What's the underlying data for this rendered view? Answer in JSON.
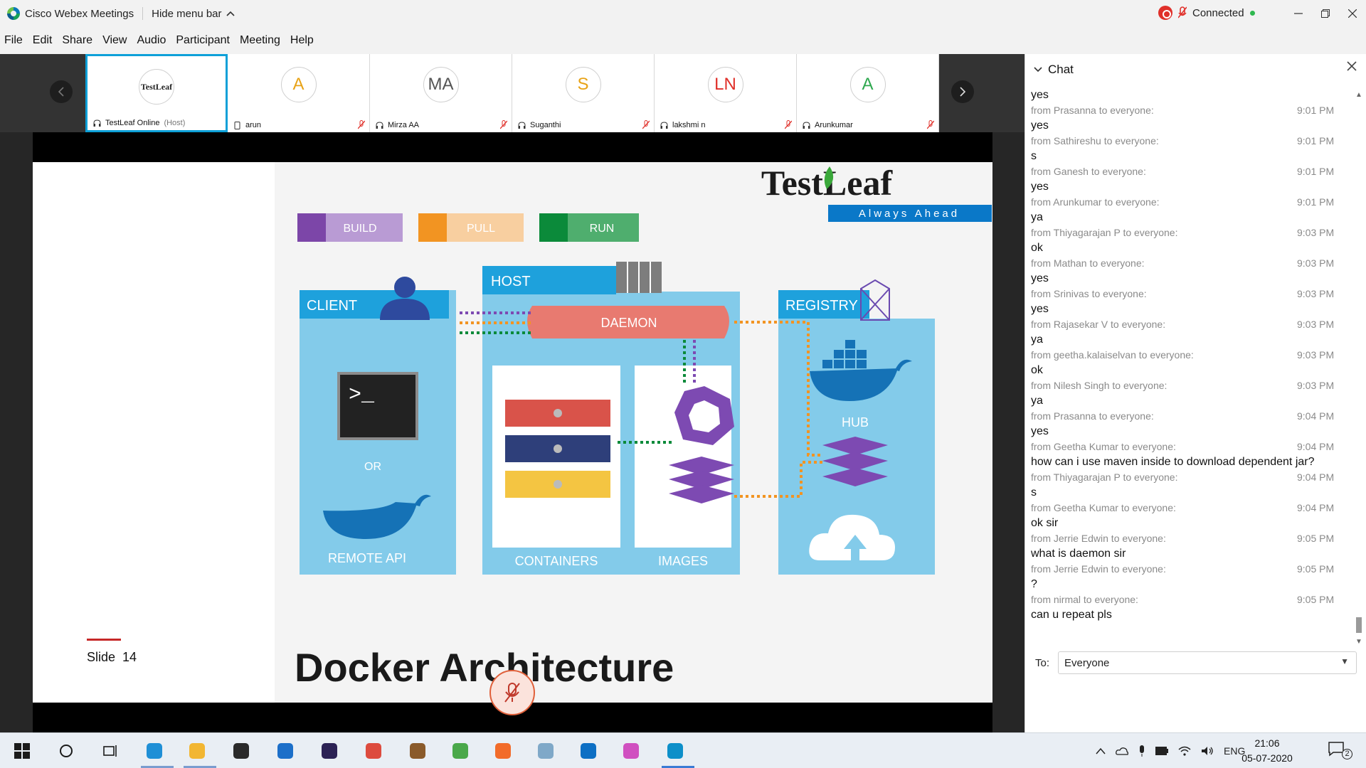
{
  "window": {
    "title": "Cisco Webex Meetings",
    "hide_menu_label": "Hide menu bar",
    "status": "Connected"
  },
  "menu": [
    "File",
    "Edit",
    "Share",
    "View",
    "Audio",
    "Participant",
    "Meeting",
    "Help"
  ],
  "participants": [
    {
      "name": "TestLeaf Online",
      "tag": "(Host)",
      "initials": "",
      "color": "#0da0d8",
      "logo": "TestLeaf"
    },
    {
      "name": "arun",
      "tag": "",
      "initials": "A",
      "color": "#e8a317"
    },
    {
      "name": "Mirza AA",
      "tag": "",
      "initials": "MA",
      "color": "#555555"
    },
    {
      "name": "Suganthi",
      "tag": "",
      "initials": "S",
      "color": "#e8a317"
    },
    {
      "name": "lakshmi n",
      "tag": "",
      "initials": "LN",
      "color": "#e0302a"
    },
    {
      "name": "Arunkumar",
      "tag": "",
      "initials": "A",
      "color": "#2fa84f"
    }
  ],
  "slide": {
    "title": "Docker Architecture",
    "slide_label": "Slide",
    "slide_number": "14",
    "logo_main": "TestLeaf",
    "logo_tag": "Always Ahead",
    "legend": [
      "BUILD",
      "PULL",
      "RUN"
    ],
    "sections": {
      "client": "CLIENT",
      "host": "HOST",
      "registry": "REGISTRY",
      "daemon": "DAEMON",
      "or": "OR",
      "remote_api": "REMOTE API",
      "containers": "CONTAINERS",
      "images": "IMAGES",
      "hub": "HUB"
    },
    "terminal_prompt": ">_"
  },
  "chat": {
    "title": "Chat",
    "to_label": "To:",
    "to_value": "Everyone",
    "messages": [
      {
        "text": "yes"
      },
      {
        "meta": "from Prasanna to everyone:",
        "time": "9:01 PM",
        "text": "yes"
      },
      {
        "meta": "from Sathireshu to everyone:",
        "time": "9:01 PM",
        "text": "s"
      },
      {
        "meta": "from Ganesh to everyone:",
        "time": "9:01 PM",
        "text": "yes"
      },
      {
        "meta": "from Arunkumar to everyone:",
        "time": "9:01 PM",
        "text": "ya"
      },
      {
        "meta": "from Thiyagarajan P to everyone:",
        "time": "9:03 PM",
        "text": "ok"
      },
      {
        "meta": "from Mathan to everyone:",
        "time": "9:03 PM",
        "text": "yes"
      },
      {
        "meta": "from Srinivas to everyone:",
        "time": "9:03 PM",
        "text": "yes"
      },
      {
        "meta": "from Rajasekar V to everyone:",
        "time": "9:03 PM",
        "text": "ya"
      },
      {
        "meta": "from geetha.kalaiselvan to everyone:",
        "time": "9:03 PM",
        "text": "ok"
      },
      {
        "meta": "from Nilesh Singh to everyone:",
        "time": "9:03 PM",
        "text": "ya"
      },
      {
        "meta": "from Prasanna to everyone:",
        "time": "9:04 PM",
        "text": "yes"
      },
      {
        "meta": "from Geetha Kumar to everyone:",
        "time": "9:04 PM",
        "text": "how can i use maven inside to download dependent jar?"
      },
      {
        "meta": "from Thiyagarajan P to everyone:",
        "time": "9:04 PM",
        "text": "s"
      },
      {
        "meta": "from Geetha Kumar to everyone:",
        "time": "9:04 PM",
        "text": "ok sir"
      },
      {
        "meta": "from Jerrie Edwin to everyone:",
        "time": "9:05 PM",
        "text": "what is daemon sir"
      },
      {
        "meta": "from Jerrie Edwin to everyone:",
        "time": "9:05 PM",
        "text": "?"
      },
      {
        "meta": "from nirmal to everyone:",
        "time": "9:05 PM",
        "text": "can u repeat pls"
      }
    ]
  },
  "taskbar": {
    "language": "ENG",
    "time": "21:06",
    "date": "05-07-2020",
    "notifications": "2",
    "apps": [
      "start-icon",
      "search-icon",
      "task-view-icon",
      "edge-icon",
      "file-explorer-icon",
      "store-icon",
      "mail-icon",
      "eclipse-icon",
      "chrome-icon",
      "app-icon",
      "notepad-icon",
      "postman-icon",
      "app2-icon",
      "teamviewer-icon",
      "app3-icon",
      "webex-icon"
    ]
  }
}
